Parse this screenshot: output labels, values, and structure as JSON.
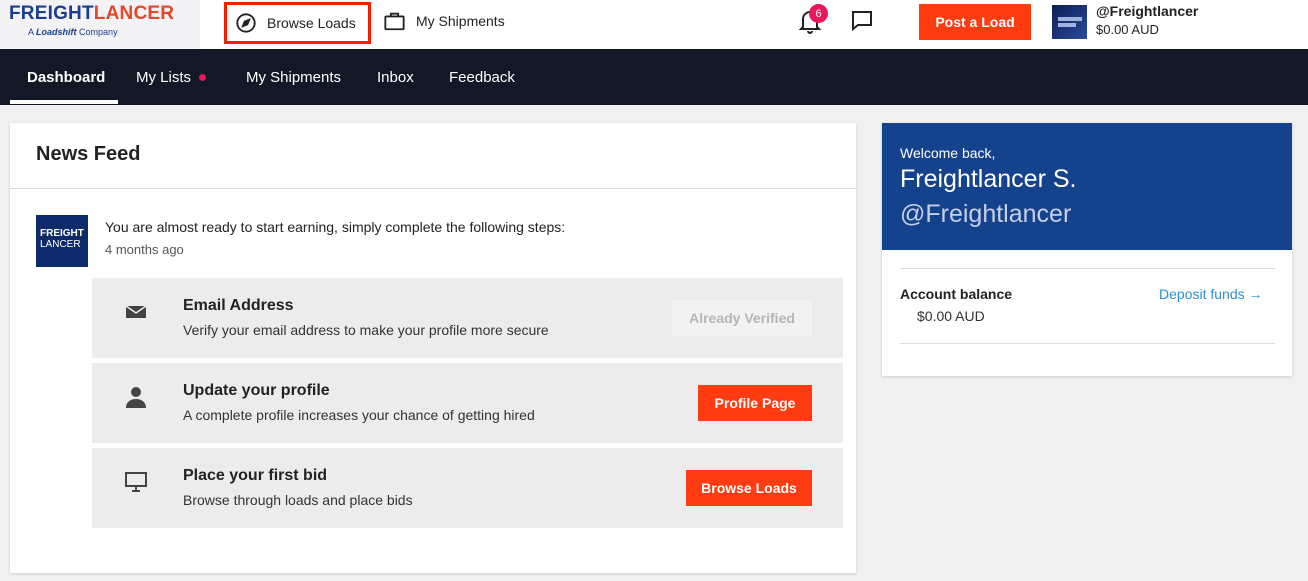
{
  "logo": {
    "name_part1": "FREIGHT",
    "name_part2": "LANCER",
    "tagline_prefix": "A",
    "tagline_brand": "Loadshift",
    "tagline_suffix": "Company"
  },
  "topnav": {
    "browse_loads": "Browse Loads",
    "my_shipments": "My Shipments",
    "notification_count": "6",
    "post_load": "Post a Load"
  },
  "user": {
    "handle": "@Freightlancer",
    "balance": "$0.00 AUD",
    "avatar_text_line1": "FREIGHT",
    "avatar_text_line2": "LANCER"
  },
  "mainnav": {
    "items": [
      {
        "label": "Dashboard"
      },
      {
        "label": "My Lists"
      },
      {
        "label": "My Shipments"
      },
      {
        "label": "Inbox"
      },
      {
        "label": "Feedback"
      }
    ]
  },
  "feed": {
    "title": "News Feed",
    "logo_line1": "FREIGHT",
    "logo_line2": "LANCER",
    "message": "You are almost ready to start earning, simply complete the following steps:",
    "time": "4 months ago",
    "steps": [
      {
        "title": "Email Address",
        "description": "Verify your email address to make your profile more secure",
        "button": "Already Verified",
        "icon": "envelope-icon"
      },
      {
        "title": "Update your profile",
        "description": "A complete profile increases your chance of getting hired",
        "button": "Profile Page",
        "icon": "person-icon"
      },
      {
        "title": "Place your first bid",
        "description": "Browse through loads and place bids",
        "button": "Browse Loads",
        "icon": "monitor-icon"
      }
    ]
  },
  "welcome": {
    "label": "Welcome back,",
    "name": "Freightlancer S.",
    "handle": "@Freightlancer",
    "balance_label": "Account balance",
    "balance_value": "$0.00 AUD",
    "deposit": "Deposit funds →"
  },
  "colors": {
    "accent": "#ff3b12",
    "brand_blue": "#15428c",
    "nav_bg": "#121826",
    "badge": "#e8185a",
    "link": "#2a8fd4"
  }
}
